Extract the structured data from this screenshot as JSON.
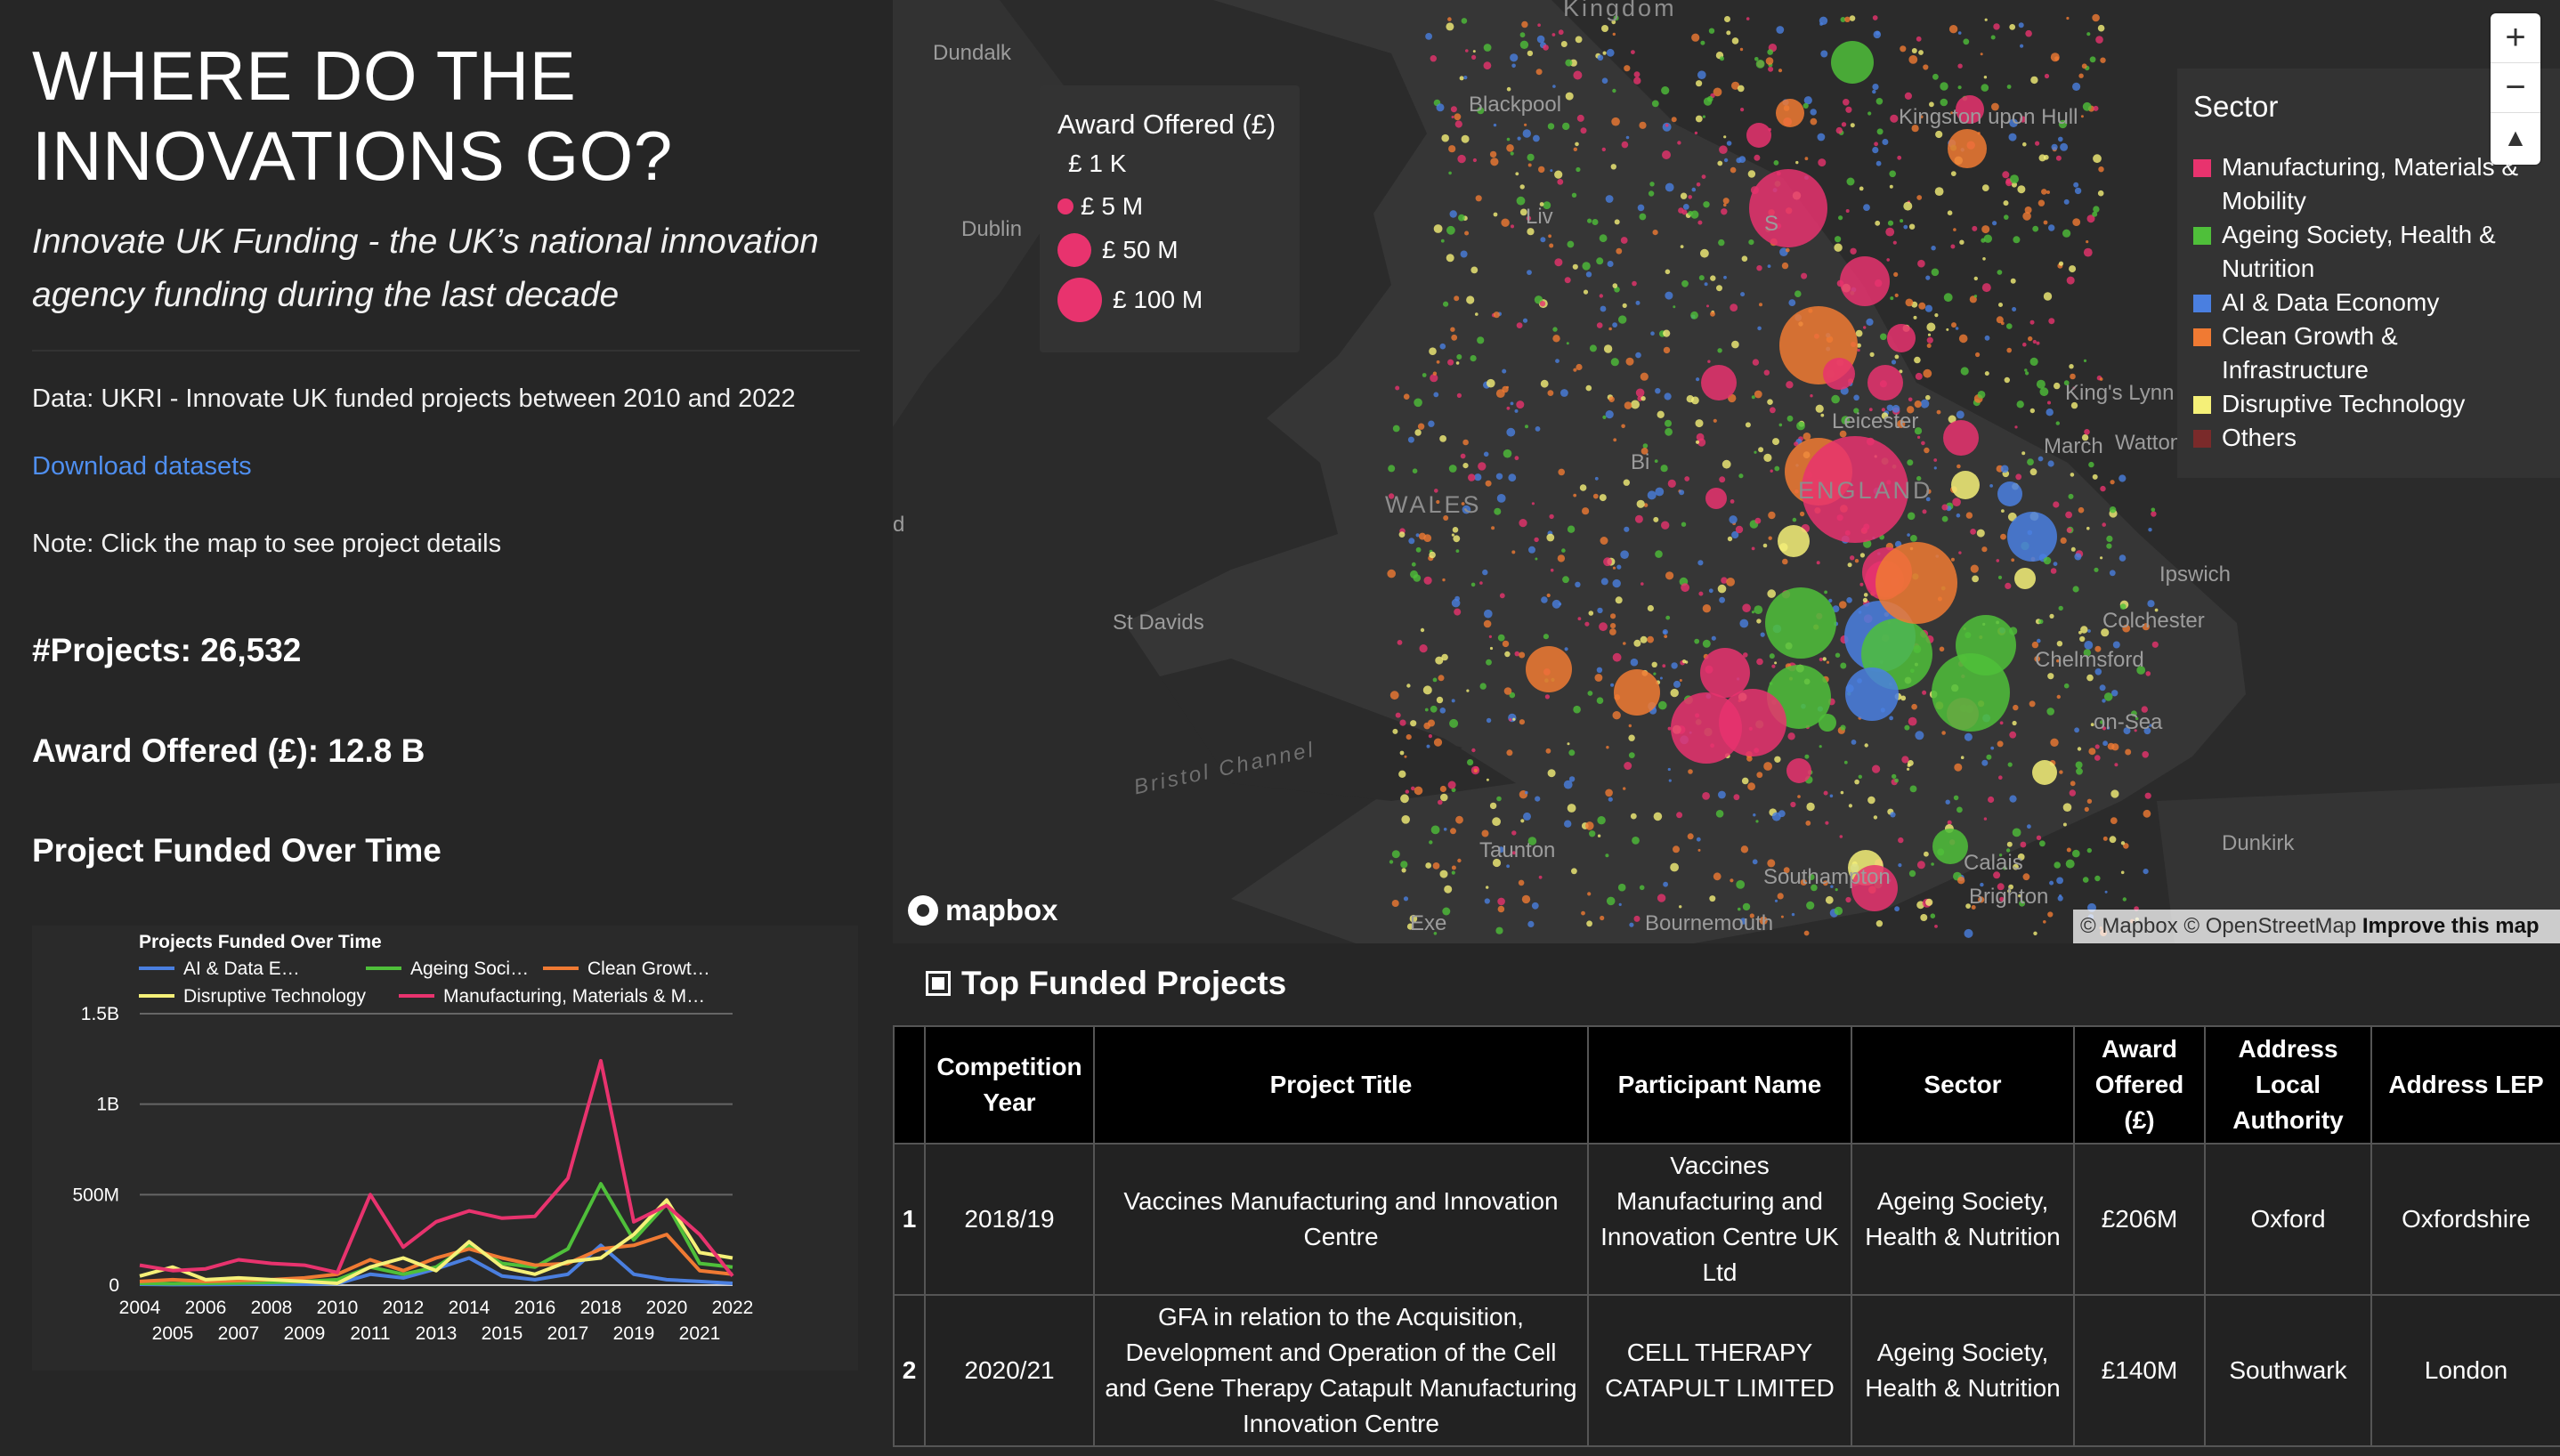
{
  "sidebar": {
    "title": "WHERE DO THE INNOVATIONS GO?",
    "subtitle": "Innovate UK Funding - the UK’s national innovation agency funding during the last decade",
    "data_source": "Data: UKRI - Innovate UK funded projects between 2010 and 2022",
    "download_link": "Download datasets",
    "note": "Note: Click the map to see project details",
    "projects_kpi": "#Projects: 26,532",
    "award_kpi": "Award Offered (£): 12.8 B",
    "chart_heading": "Project Funded Over Time"
  },
  "chart_data": {
    "type": "line",
    "title": "Projects Funded Over Time",
    "x": [
      2004,
      2005,
      2006,
      2007,
      2008,
      2009,
      2010,
      2011,
      2012,
      2013,
      2014,
      2015,
      2016,
      2017,
      2018,
      2019,
      2020,
      2021,
      2022
    ],
    "x_ticks_top": [
      "2004",
      "2006",
      "2008",
      "2010",
      "2012",
      "2014",
      "2016",
      "2018",
      "2020",
      "2022"
    ],
    "x_ticks_bottom": [
      "2005",
      "2007",
      "2009",
      "2011",
      "2013",
      "2015",
      "2017",
      "2019",
      "2021"
    ],
    "y_ticks": [
      "1.5B",
      "1B",
      "500M",
      "0"
    ],
    "ylim": [
      0,
      1500000000
    ],
    "grid": true,
    "legend_position": "top",
    "series": [
      {
        "name": "AI & Data E…",
        "color": "#4a7fe0",
        "values": [
          5000000,
          3000000,
          4000000,
          5000000,
          6000000,
          5000000,
          8000000,
          60000000,
          40000000,
          90000000,
          150000000,
          50000000,
          30000000,
          60000000,
          220000000,
          60000000,
          30000000,
          20000000,
          10000000
        ]
      },
      {
        "name": "Ageing Soci…",
        "color": "#4fbf3a",
        "values": [
          10000000,
          8000000,
          10000000,
          12000000,
          15000000,
          20000000,
          30000000,
          100000000,
          60000000,
          100000000,
          220000000,
          120000000,
          100000000,
          200000000,
          560000000,
          250000000,
          450000000,
          120000000,
          100000000
        ]
      },
      {
        "name": "Clean Growt…",
        "color": "#f07a33",
        "values": [
          20000000,
          30000000,
          20000000,
          25000000,
          30000000,
          40000000,
          60000000,
          140000000,
          80000000,
          150000000,
          200000000,
          150000000,
          110000000,
          120000000,
          200000000,
          220000000,
          280000000,
          80000000,
          60000000
        ]
      },
      {
        "name": "Disruptive Technology",
        "color": "#f5f078",
        "values": [
          50000000,
          100000000,
          30000000,
          40000000,
          30000000,
          20000000,
          10000000,
          100000000,
          150000000,
          80000000,
          240000000,
          100000000,
          60000000,
          130000000,
          150000000,
          280000000,
          470000000,
          180000000,
          150000000
        ]
      },
      {
        "name": "Manufacturing, Materials & M…",
        "color": "#e8336e",
        "values": [
          110000000,
          80000000,
          90000000,
          140000000,
          120000000,
          110000000,
          70000000,
          500000000,
          210000000,
          350000000,
          410000000,
          370000000,
          380000000,
          590000000,
          1240000000,
          350000000,
          440000000,
          280000000,
          50000000
        ]
      }
    ]
  },
  "map": {
    "place_labels": [
      "Kingdom",
      "Dundalk",
      "Blackpool",
      "Dublin",
      "Liv",
      "Sea",
      "Kingston upon Hull",
      "King's Lynn",
      "Watton",
      "Leicester",
      "Bi",
      "ENGLAND",
      "WALES",
      "St Davids",
      "Ipswich",
      "Colchester",
      "Chelmsford",
      "on-Sea",
      "Bristol Channel",
      "Calais",
      "Dunkirk",
      "Taunton",
      "Southampton",
      "Exe",
      "Bournemouth",
      "Brighton",
      "S",
      "d",
      "March"
    ],
    "size_legend": {
      "title": "Award Offered (£)",
      "items": [
        "£ 1 K",
        "£ 5 M",
        "£ 50 M",
        "£ 100 M"
      ]
    },
    "sector_legend": {
      "title": "Sector",
      "items": [
        {
          "label": "Manufacturing, Materials & Mobility",
          "color": "#e8336e"
        },
        {
          "label": "Ageing Society, Health & Nutrition",
          "color": "#4fbf3a"
        },
        {
          "label": "AI & Data Economy",
          "color": "#4a7fe0"
        },
        {
          "label": "Clean Growth & Infrastructure",
          "color": "#f07a33"
        },
        {
          "label": "Disruptive Technology",
          "color": "#f5f078"
        },
        {
          "label": "Others",
          "color": "#7a2a2a"
        }
      ]
    },
    "controls": {
      "zoom_in": "+",
      "zoom_out": "−",
      "compass": "▲"
    },
    "logo": "mapbox",
    "attribution": "© Mapbox © OpenStreetMap",
    "improve": "Improve this map"
  },
  "table": {
    "title": "Top Funded Projects",
    "columns": [
      "",
      "Competition Year",
      "Project Title",
      "Participant Name",
      "Sector",
      "Award Offered (£)",
      "Address Local Authority",
      "Address LEP"
    ],
    "rows": [
      [
        "1",
        "2018/19",
        "Vaccines Manufacturing and Innovation Centre",
        "Vaccines Manufacturing and Innovation Centre UK Ltd",
        "Ageing Society, Health & Nutrition",
        "£206M",
        "Oxford",
        "Oxfordshire"
      ],
      [
        "2",
        "2020/21",
        "GFA in relation to the Acquisition, Development and Operation of the Cell and Gene Therapy Catapult Manufacturing Innovation Centre",
        "CELL THERAPY CATAPULT LIMITED",
        "Ageing Society, Health & Nutrition",
        "£140M",
        "Southwark",
        "London"
      ]
    ]
  },
  "colors": {
    "background": "#262626",
    "link": "#4f8ff0",
    "accent": "#e8336e"
  }
}
